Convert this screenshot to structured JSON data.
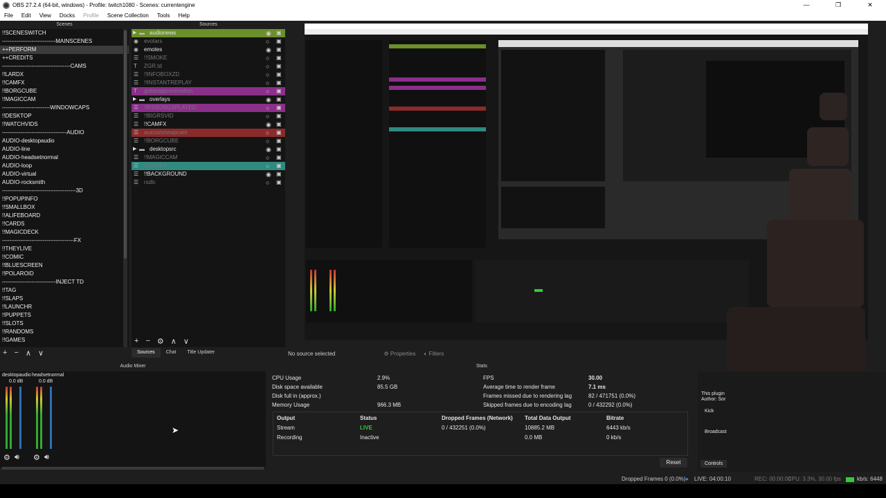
{
  "window": {
    "title": "OBS 27.2.4 (64-bit, windows) - Profile: twitch1080 - Scenes: currentengine"
  },
  "menu": {
    "items": [
      "File",
      "Edit",
      "View",
      "Docks",
      "Profile",
      "Scene Collection",
      "Tools",
      "Help"
    ]
  },
  "scenes": {
    "title": "Scenes",
    "items": [
      "!!SCENESWITCH",
      "-----------------------------MAINSCENES",
      "++PERFORM",
      "++CREDITS",
      "-------------------------------------CAMS",
      "!!LARDX",
      "!!CAMFX",
      "!!BORGCUBE",
      "!!MAGICCAM",
      "--------------------------WINDOWCAPS",
      "!!DESKTOP",
      "!!WATCHVIDS",
      "-----------------------------------AUDIO",
      "AUDIO-desktopaudio",
      "AUDIO-line",
      "AUDIO-headsetnormal",
      "AUDIO-loop",
      "AUDIO-virtual",
      "AUDIO-rocksmith",
      "----------------------------------------3D",
      "!!POPUPINFO",
      "!!SMALLBOX",
      "!!ALIFEBOARD",
      "!!CARDS",
      "!!MAGICDECK",
      "---------------------------------------FX",
      "!!THEYLIVE",
      "!!COMIC",
      "!!BLUESCREEN",
      "!!POLAROID",
      "-----------------------------INJECT TD",
      "!!TAG",
      "!!SLAPS",
      "!!LAUNCHR",
      "!!PUPPETS",
      "!!SLOTS",
      "!!RANDOMS",
      "!!GAMES"
    ]
  },
  "sources": {
    "title": "Sources",
    "items": [
      {
        "label": "audionews",
        "type": "folder",
        "color": "#6b8f2a",
        "visible": true
      },
      {
        "label": "evotars",
        "type": "game",
        "color": "",
        "visible": false
      },
      {
        "label": "emotes",
        "type": "game",
        "color": "",
        "visible": true
      },
      {
        "label": "!!SMOKE",
        "type": "list",
        "color": "",
        "visible": false
      },
      {
        "label": "ZGR.td",
        "type": "text",
        "color": "",
        "visible": false
      },
      {
        "label": "!!INFOBOXZD",
        "type": "list",
        "color": "",
        "visible": false
      },
      {
        "label": "!!INSTANTREPLAY",
        "type": "list",
        "color": "",
        "visible": false
      },
      {
        "label": "guitarapproximation",
        "type": "text",
        "color": "#8a2f8a",
        "visible": false
      },
      {
        "label": "overlays",
        "type": "folder",
        "color": "",
        "visible": true
      },
      {
        "label": "!!RSSONGSPLAYED",
        "type": "list",
        "color": "#8a2f8a",
        "visible": false
      },
      {
        "label": "!!BIGRSVID",
        "type": "list",
        "color": "",
        "visible": false
      },
      {
        "label": "!!CAMFX",
        "type": "list",
        "color": "",
        "visible": true
      },
      {
        "label": "auxcam/snapcam",
        "type": "list",
        "color": "#8a2b2b",
        "visible": false
      },
      {
        "label": "!!BORGCUBE",
        "type": "list",
        "color": "",
        "visible": false
      },
      {
        "label": "desktopsrc",
        "type": "folder",
        "color": "",
        "visible": true
      },
      {
        "label": "!!MAGICCAM",
        "type": "list",
        "color": "",
        "visible": false
      },
      {
        "label": "!!CAMFX",
        "type": "list",
        "color": "#2f8a80",
        "visible": false
      },
      {
        "label": "!!BACKGROUND",
        "type": "list",
        "color": "",
        "visible": true
      },
      {
        "label": "rsdlc",
        "type": "list",
        "color": "",
        "visible": false
      }
    ]
  },
  "toolbar": {
    "add": "+",
    "remove": "−",
    "up": "∧",
    "down": "∨",
    "settings": "⚙"
  },
  "tabs": {
    "items": [
      "Sources",
      "Chat",
      "Title Updater"
    ],
    "selected": "Sources"
  },
  "source_bar": {
    "status": "No source selected",
    "properties": "Properties",
    "filters": "Filters"
  },
  "audio_mixer": {
    "title": "Audio Mixer",
    "channels": [
      {
        "name": "desktopaudio",
        "db": "0.0 dB"
      },
      {
        "name": "headsetnormal",
        "db": "0.0 dB"
      }
    ]
  },
  "stats": {
    "title": "Stats",
    "left": [
      {
        "label": "CPU Usage",
        "value": "2.9%"
      },
      {
        "label": "Disk space available",
        "value": "85.5 GB"
      },
      {
        "label": "Disk full in (approx.)",
        "value": ""
      },
      {
        "label": "Memory Usage",
        "value": "966.3 MB"
      }
    ],
    "right": [
      {
        "label": "FPS",
        "value": "30.00"
      },
      {
        "label": "Average time to render frame",
        "value": "7.1 ms"
      },
      {
        "label": "Frames missed due to rendering lag",
        "value": "82 / 471751 (0.0%)"
      },
      {
        "label": "Skipped frames due to encoding lag",
        "value": "0 / 432292 (0.0%)"
      }
    ],
    "table": {
      "headers": [
        "Output",
        "Status",
        "Dropped Frames (Network)",
        "Total Data Output",
        "Bitrate"
      ],
      "rows": [
        [
          "Stream",
          "LIVE",
          "0 / 432251 (0.0%)",
          "10885.2 MB",
          "6443 kb/s"
        ],
        [
          "Recording",
          "Inactive",
          "",
          "0.0 MB",
          "0 kb/s"
        ]
      ]
    },
    "reset": "Reset"
  },
  "controls": {
    "tab": "Controls",
    "plugin_text": "This plugin",
    "author": "Author: Sor",
    "kick": "Kick",
    "broadcast": "Broadcast"
  },
  "status_bar": {
    "dropped": "Dropped Frames 0 (0.0%)",
    "live": "LIVE: 04:00:10",
    "rec": "REC: 00:00:00",
    "cpu": "CPU: 3.3%, 30.00 fps",
    "kbps": "kb/s: 6448"
  },
  "colors": {
    "live": "#33cc33",
    "accent_green": "#6b8f2a",
    "accent_purple": "#8a2f8a",
    "accent_red": "#8a2b2b",
    "accent_teal": "#2f8a80"
  }
}
